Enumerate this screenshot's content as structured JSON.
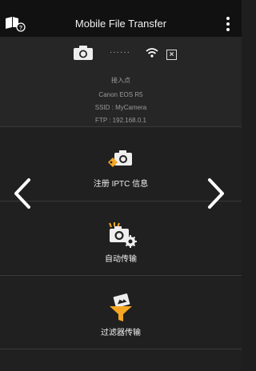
{
  "header": {
    "title": "Mobile File Transfer",
    "help_icon": "book-help-icon",
    "more_icon": "more-vertical-icon"
  },
  "connection": {
    "camera_icon": "camera-icon",
    "dots": "······",
    "wifi_icon": "wifi-icon",
    "close_icon": "close-icon",
    "access_point_label": "接入点",
    "camera_model": "Canon EOS R5",
    "ssid": "SSID : MyCamera",
    "ftp": "FTP : 192.168.0.1"
  },
  "menu": [
    {
      "label": "注册 IPTC 信息",
      "icon": "iptc-tag-camera-icon"
    },
    {
      "label": "自动传输",
      "icon": "auto-transfer-icon"
    },
    {
      "label": "过滤器传输",
      "icon": "filter-transfer-icon"
    }
  ],
  "nav": {
    "prev_icon": "chevron-left-icon",
    "next_icon": "chevron-right-icon"
  },
  "colors": {
    "accent": "#f5a623",
    "background": "#1e1e1e",
    "header": "#111111"
  }
}
